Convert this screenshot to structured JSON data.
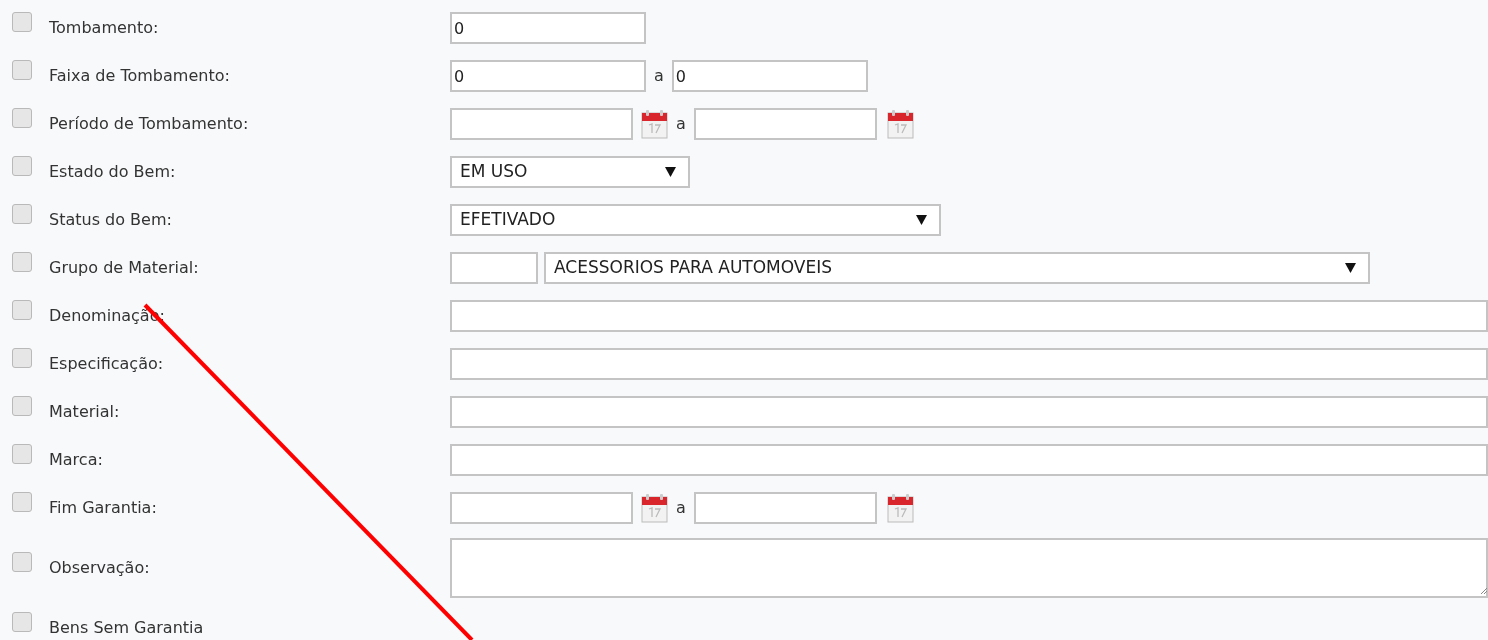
{
  "fields": [
    {
      "kind": "text",
      "label": "Tombamento:",
      "checked": false,
      "value": "0"
    },
    {
      "kind": "range",
      "label": "Faixa de Tombamento:",
      "checked": false,
      "value": "0",
      "separator": "a",
      "value_to": "0"
    },
    {
      "kind": "date_range",
      "label": "Período de Tombamento:",
      "checked": false,
      "separator": "a"
    },
    {
      "kind": "select",
      "label": "Estado do Bem:",
      "checked": false,
      "value": "EM USO"
    },
    {
      "kind": "select_wide",
      "label": "Status do Bem:",
      "checked": false,
      "value": "EFETIVADO"
    },
    {
      "kind": "group",
      "label": "Grupo de Material:",
      "checked": false,
      "value": "ACESSORIOS PARA AUTOMOVEIS"
    },
    {
      "kind": "wide_text",
      "label": "Denominação:",
      "checked": false
    },
    {
      "kind": "wide_text",
      "label": "Especificação:",
      "checked": false
    },
    {
      "kind": "wide_text",
      "label": "Material:",
      "checked": false
    },
    {
      "kind": "wide_text",
      "label": "Marca:",
      "checked": false
    },
    {
      "kind": "date_range",
      "label": "Fim Garantia:",
      "checked": false,
      "separator": "a"
    },
    {
      "kind": "textarea",
      "label": "Observação:",
      "checked": false
    },
    {
      "kind": "none",
      "label": "Bens Sem Garantia",
      "checked": false
    }
  ]
}
